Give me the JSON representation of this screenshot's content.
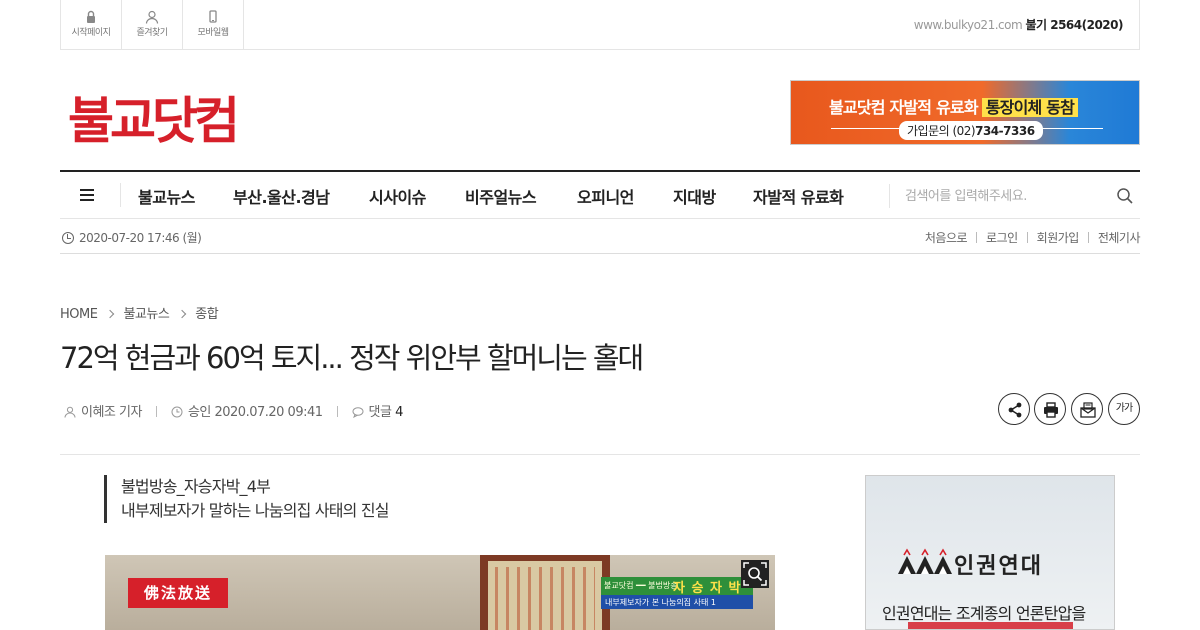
{
  "topbar": {
    "items": [
      {
        "label": "시작페이지",
        "icon": "lock-icon"
      },
      {
        "label": "즐겨찾기",
        "icon": "user-icon"
      },
      {
        "label": "모바일웹",
        "icon": "mobile-icon"
      }
    ],
    "site_url": "www.bulkyo21.com",
    "year_label": "불기 2564(2020)"
  },
  "logo": {
    "text": "불교닷컴",
    "color": "#d6202a"
  },
  "banner": {
    "line1": "불교닷컴 자발적 유료화",
    "line1_highlight": "통장이체 동참",
    "line2_prefix": "가입문의 (02)",
    "line2_number": "734-7336"
  },
  "nav": {
    "items": [
      "불교뉴스",
      "부산.울산.경남",
      "시사이슈",
      "비주얼뉴스",
      "오피니언",
      "지대방",
      "자발적 유료화"
    ],
    "search_placeholder": "검색어를 입력해주세요."
  },
  "datebar": {
    "date": "2020-07-20 17:46 (월)",
    "links": [
      "처음으로",
      "로그인",
      "회원가입",
      "전체기사"
    ]
  },
  "breadcrumb": [
    "HOME",
    "불교뉴스",
    "종합"
  ],
  "article": {
    "headline": "72억 현금과 60억 토지... 정작 위안부 할머니는 홀대",
    "author": "이혜조 기자",
    "approved": "승인 2020.07.20 09:41",
    "comments_label": "댓글",
    "comments_count": "4",
    "subtitle1": "불법방송_자승자박_4부",
    "subtitle2": "내부제보자가 말하는 나눔의집 사태의 진실",
    "font_tool_label": "가가"
  },
  "photo": {
    "badge": "佛法放送",
    "caption_brand": "불교닷컴 ━━ 불법방송",
    "caption_title": "자 승 자 박",
    "caption_sub": "내부제보자가 본 나눔의집 사태 1"
  },
  "ad": {
    "title": "인권연대",
    "text": "인권연대는 조계종의 언론탄압을"
  },
  "colors": {
    "accent_red": "#d6202a",
    "banner_orange": "#f06a2a",
    "banner_blue": "#1f7ad6"
  }
}
